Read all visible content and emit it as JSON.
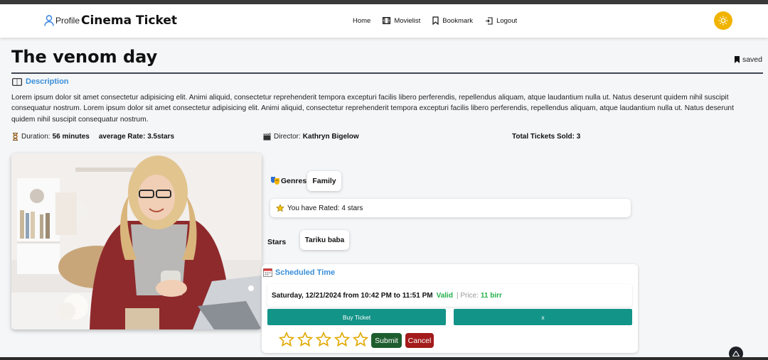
{
  "navbar": {
    "profile_label": "Profile",
    "brand": "Cinema Ticket",
    "links": [
      {
        "label": "Home",
        "icon": "none"
      },
      {
        "label": "Movielist",
        "icon": "film-icon"
      },
      {
        "label": "Bookmark",
        "icon": "bookmark-icon"
      },
      {
        "label": "Logout",
        "icon": "logout-icon"
      }
    ],
    "theme_icon": "sun-icon",
    "theme_color": "#f0b400"
  },
  "movie": {
    "title": "The venom day",
    "saved_label": "saved",
    "description_heading": "Description",
    "description": "Lorem ipsum dolor sit amet consectetur adipisicing elit. Animi aliquid, consectetur reprehenderit tempora excepturi facilis libero perferendis, repellendus aliquam, atque laudantium nulla ut. Natus deserunt quidem nihil suscipit consequatur nostrum. Lorem ipsum dolor sit amet consectetur adipisicing elit. Animi aliquid, consectetur reprehenderit tempora excepturi facilis libero perferendis, repellendus aliquam, atque laudantium nulla ut. Natus deserunt quidem nihil suscipit consequatur nostrum.",
    "duration_label": "Duration:",
    "duration_value": "56 minutes",
    "average_rate": "average Rate: 3.5stars",
    "director_label": "Director:",
    "director_value": "Kathryn Bigelow",
    "total_tickets": "Total Tickets Sold: 3",
    "genres_label": "Genres",
    "genre": "Family",
    "rated_text": "You have Rated: 4 stars",
    "stars_label": "Stars",
    "star_actor": "Tariku baba",
    "scheduled_heading": "Scheduled Time",
    "schedule_time": "Saturday, 12/21/2024 from 10:42 PM to 11:51 PM",
    "schedule_status": "Valid",
    "price_label": "| Price:",
    "price_value": "11 birr",
    "buy_label": "Buy Ticket",
    "close_label": "x",
    "rating_stars": 5,
    "submit_label": "Submit",
    "cancel_label": "Cancel"
  },
  "colors": {
    "accent_blue": "#3b8fd9",
    "teal": "#139488",
    "valid_green": "#22b04a",
    "submit_green": "#1e5e2e",
    "cancel_red": "#a31b1b"
  }
}
